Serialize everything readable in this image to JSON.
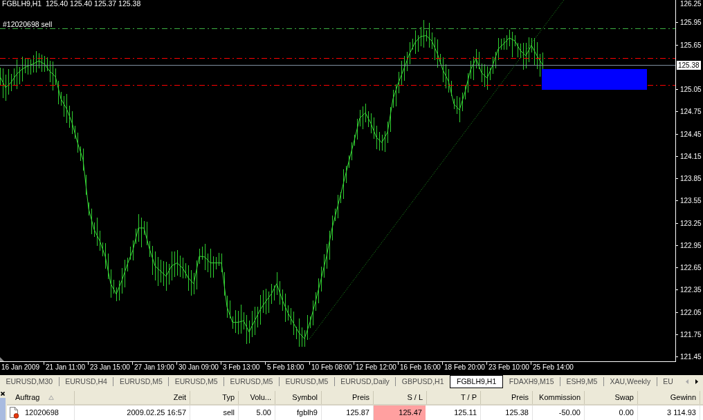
{
  "chart": {
    "chart_data": {
      "type": "line",
      "title": "FGBLH9,H1  125.40 125.40 125.37 125.38",
      "ylim": [
        121.385,
        126.25
      ],
      "categories": [
        null,
        null,
        null,
        null,
        "16 Jan 2009",
        null,
        null,
        null,
        null,
        null,
        null,
        null,
        "21 Jan 11:00",
        null,
        null,
        null,
        null,
        null,
        null,
        null,
        "23 Jan 15:00",
        null,
        null,
        null,
        null,
        null,
        null,
        null,
        "27 Jan 19:00",
        null,
        null,
        null,
        null,
        null,
        null,
        null,
        "30 Jan 09:00",
        null,
        null,
        null,
        null,
        null,
        null,
        null,
        "3 Feb 13:00",
        null,
        null,
        null,
        null,
        null,
        null,
        null,
        "5 Feb 18:00",
        null,
        null,
        null,
        null,
        null,
        null,
        null,
        "10 Feb 08:00",
        null,
        null,
        null,
        null,
        null,
        null,
        null,
        "12 Feb 12:00",
        null,
        null,
        null,
        null,
        null,
        null,
        null,
        "16 Feb 16:00",
        null,
        null,
        null,
        null,
        null,
        null,
        null,
        "18 Feb 20:00",
        null,
        null,
        null,
        null,
        null,
        null,
        null,
        "23 Feb 10:00",
        null,
        null,
        null,
        null,
        null,
        null,
        null,
        "25 Feb 14:00"
      ],
      "yticks": [
        126.25,
        125.95,
        125.65,
        125.05,
        124.75,
        124.45,
        124.15,
        123.85,
        123.55,
        123.25,
        122.95,
        122.65,
        122.35,
        122.05,
        121.75,
        121.45
      ],
      "series": [
        {
          "values": [
            125.22,
            125.07,
            125.14,
            125.25,
            125.32,
            125.36,
            125.39,
            125.43,
            125.39,
            125.29,
            125.22,
            124.92,
            124.79,
            124.6,
            124.33,
            124.1,
            123.44,
            123.16,
            123.01,
            122.8,
            122.43,
            122.29,
            122.47,
            122.69,
            122.88,
            123.18,
            123.18,
            122.9,
            122.67,
            122.6,
            122.53,
            122.67,
            122.71,
            122.64,
            122.51,
            122.43,
            122.8,
            122.79,
            122.71,
            122.71,
            122.71,
            122.12,
            121.91,
            121.91,
            121.93,
            121.78,
            121.93,
            122.08,
            122.19,
            122.29,
            122.43,
            122.21,
            122.04,
            121.9,
            121.77,
            121.69,
            121.91,
            122.19,
            122.49,
            122.8,
            123.18,
            123.47,
            123.77,
            124.07,
            124.36,
            124.66,
            124.73,
            124.59,
            124.4,
            124.33,
            124.47,
            124.92,
            125.14,
            125.33,
            125.53,
            125.68,
            125.76,
            125.77,
            125.7,
            125.53,
            125.31,
            125.16,
            124.85,
            124.77,
            125.01,
            125.31,
            125.46,
            125.27,
            125.2,
            125.37,
            125.59,
            125.66,
            125.74,
            125.7,
            125.57,
            125.5,
            125.64,
            125.5,
            125.38,
            null,
            null
          ]
        }
      ],
      "ref_lines": [
        {
          "axis": "y",
          "value": 125.87,
          "label": "#12020698 sell",
          "color": "#3cb043"
        },
        {
          "axis": "y",
          "value": 125.47,
          "color": "#ff0000"
        },
        {
          "axis": "y",
          "value": 125.11,
          "color": "#ff0000"
        },
        {
          "axis": "y",
          "value": 125.38,
          "label": "125.38",
          "color": "#8090a0"
        }
      ]
    }
  },
  "tabs": [
    {
      "label": "EURUSD,M30",
      "selected": false
    },
    {
      "label": "EURUSD,H4",
      "selected": false
    },
    {
      "label": "EURUSD,M5",
      "selected": false
    },
    {
      "label": "EURUSD,M5",
      "selected": false
    },
    {
      "label": "EURUSD,M5",
      "selected": false
    },
    {
      "label": "EURUSD,M5",
      "selected": false
    },
    {
      "label": "EURUSD,Daily",
      "selected": false
    },
    {
      "label": "GBPUSD,H1",
      "selected": false
    },
    {
      "label": "FGBLH9,H1",
      "selected": true
    },
    {
      "label": "FDAXH9,M15",
      "selected": false
    },
    {
      "label": "ESH9,M5",
      "selected": false
    },
    {
      "label": "XAU,Weekly",
      "selected": false
    },
    {
      "label": "EU",
      "selected": false
    }
  ],
  "tab_scroll": [
    {
      "kind": "left",
      "disabled": true
    },
    {
      "kind": "right",
      "disabled": false
    }
  ],
  "terminal": {
    "columns": [
      {
        "label": "Auftrag",
        "sorted": true
      },
      {
        "label": "Zeit",
        "sorted": false
      },
      {
        "label": "Typ",
        "sorted": false
      },
      {
        "label": "Volu...",
        "sorted": false
      },
      {
        "label": "Symbol",
        "sorted": false
      },
      {
        "label": "Preis",
        "sorted": false
      },
      {
        "label": "S / L",
        "sorted": false
      },
      {
        "label": "T / P",
        "sorted": false
      },
      {
        "label": "Preis",
        "sorted": false
      },
      {
        "label": "Kommission",
        "sorted": false
      },
      {
        "label": "Swap",
        "sorted": false
      },
      {
        "label": "Gewinn",
        "sorted": false
      }
    ],
    "rows": [
      {
        "cells": [
          {
            "text": "12020698",
            "highlighted": false
          },
          {
            "text": "2009.02.25 16:57",
            "highlighted": false
          },
          {
            "text": "sell",
            "highlighted": false
          },
          {
            "text": "5.00",
            "highlighted": false
          },
          {
            "text": "fgblh9",
            "highlighted": false
          },
          {
            "text": "125.87",
            "highlighted": false
          },
          {
            "text": "125.47",
            "highlighted": true
          },
          {
            "text": "125.11",
            "highlighted": false
          },
          {
            "text": "125.38",
            "highlighted": false
          },
          {
            "text": "-50.00",
            "highlighted": false
          },
          {
            "text": "0.00",
            "highlighted": false
          },
          {
            "text": "3 114.93",
            "highlighted": false
          }
        ]
      }
    ]
  }
}
